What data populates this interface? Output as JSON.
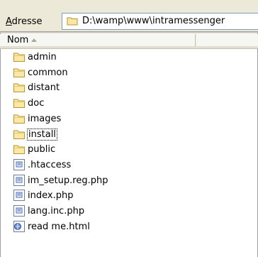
{
  "address": {
    "label_prefix": "A",
    "label_rest": "dresse",
    "path": "D:\\wamp\\www\\intramessenger"
  },
  "header": {
    "name_column": "Nom",
    "sort_icon": "sort-ascending-icon"
  },
  "files": [
    {
      "name": "admin",
      "icon": "folder-icon"
    },
    {
      "name": "common",
      "icon": "folder-icon"
    },
    {
      "name": "distant",
      "icon": "folder-icon"
    },
    {
      "name": "doc",
      "icon": "folder-icon"
    },
    {
      "name": "images",
      "icon": "folder-icon"
    },
    {
      "name": "install",
      "icon": "folder-icon",
      "focused": true
    },
    {
      "name": "public",
      "icon": "folder-icon"
    },
    {
      "name": ".htaccess",
      "icon": "text-file-icon"
    },
    {
      "name": "im_setup.reg.php",
      "icon": "text-file-icon"
    },
    {
      "name": "index.php",
      "icon": "text-file-icon"
    },
    {
      "name": "lang.inc.php",
      "icon": "text-file-icon"
    },
    {
      "name": "read me.html",
      "icon": "html-file-icon"
    }
  ]
}
